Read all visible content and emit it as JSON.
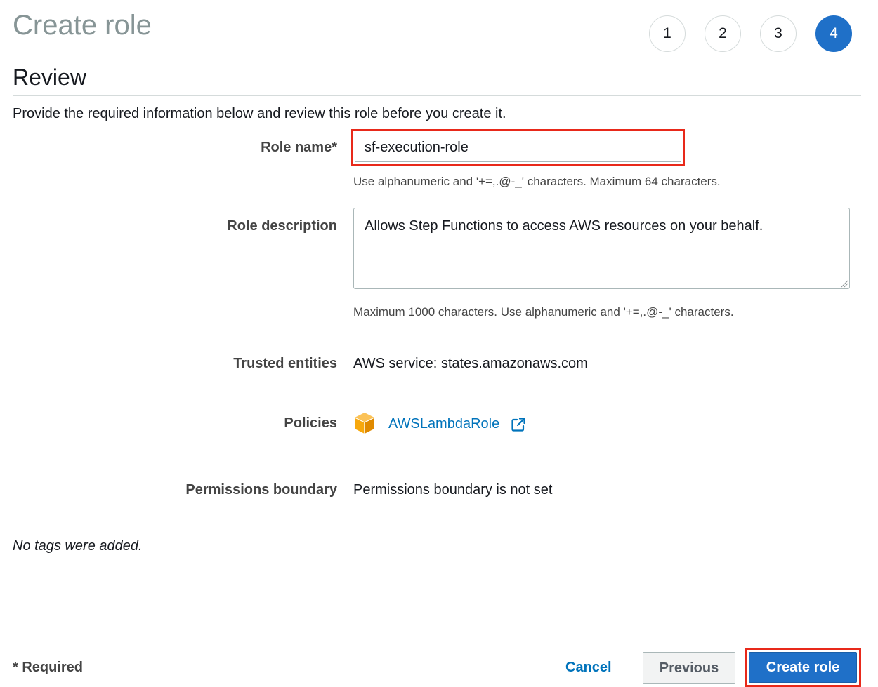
{
  "page": {
    "title": "Create role",
    "section_title": "Review",
    "intro": "Provide the required information below and review this role before you create it."
  },
  "steps": [
    {
      "label": "1",
      "active": false
    },
    {
      "label": "2",
      "active": false
    },
    {
      "label": "3",
      "active": false
    },
    {
      "label": "4",
      "active": true
    }
  ],
  "form": {
    "role_name": {
      "label": "Role name*",
      "value": "sf-execution-role",
      "hint": "Use alphanumeric and '+=,.@-_' characters. Maximum 64 characters."
    },
    "role_description": {
      "label": "Role description",
      "value": "Allows Step Functions to access AWS resources on your behalf.",
      "hint": "Maximum 1000 characters. Use alphanumeric and '+=,.@-_' characters."
    },
    "trusted_entities": {
      "label": "Trusted entities",
      "value": "AWS service: states.amazonaws.com"
    },
    "policies": {
      "label": "Policies",
      "items": [
        {
          "name": "AWSLambdaRole",
          "icon": "policy-cube-icon"
        }
      ]
    },
    "permissions_boundary": {
      "label": "Permissions boundary",
      "value": "Permissions boundary is not set"
    },
    "tags_note": "No tags were added."
  },
  "footer": {
    "required_note": "* Required",
    "cancel_label": "Cancel",
    "previous_label": "Previous",
    "create_label": "Create role"
  },
  "colors": {
    "primary": "#1f70c8",
    "link": "#0073bb",
    "highlight": "#e8291a",
    "policy_icon": "#f7a80d"
  }
}
